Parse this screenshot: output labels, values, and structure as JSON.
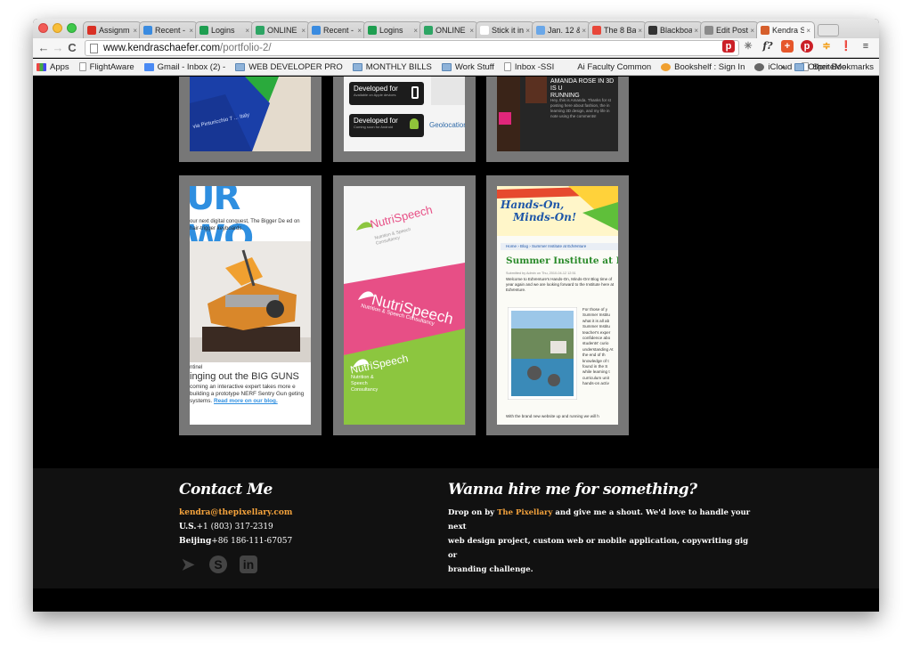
{
  "browser": {
    "tabs": [
      {
        "label": "Assignm",
        "color": "#d93025"
      },
      {
        "label": "Recent -",
        "color": "#3a8be0"
      },
      {
        "label": "Logins",
        "color": "#1e9e50"
      },
      {
        "label": "ONLINE F",
        "color": "#2da564"
      },
      {
        "label": "Recent -",
        "color": "#3a8be0"
      },
      {
        "label": "Logins",
        "color": "#1e9e50"
      },
      {
        "label": "ONLINE F",
        "color": "#2da564"
      },
      {
        "label": "Stick it in",
        "color": "#ffffff"
      },
      {
        "label": "Jan. 12 &",
        "color": "#6aa7e8"
      },
      {
        "label": "The 8 Ba",
        "color": "#e8473a"
      },
      {
        "label": "Blackboa",
        "color": "#333333"
      },
      {
        "label": "Edit Post",
        "color": "#8a8a8a"
      },
      {
        "label": "Kendra S",
        "color": "#d65f2c"
      }
    ],
    "url_host": "www.kendraschaefer.com",
    "url_path": "/portfolio-2/",
    "bookmarks": [
      {
        "label": "Apps",
        "kind": "apps"
      },
      {
        "label": "FlightAware",
        "kind": "file"
      },
      {
        "label": "Gmail - Inbox (2) - ",
        "kind": "gmail"
      },
      {
        "label": "WEB DEVELOPER PRO",
        "kind": "folder"
      },
      {
        "label": "MONTHLY BILLS",
        "kind": "folder"
      },
      {
        "label": "Work Stuff",
        "kind": "folder"
      },
      {
        "label": "Inbox -SSI",
        "kind": "file"
      },
      {
        "label": "Ai Faculty Common",
        "kind": "ai"
      },
      {
        "label": "Bookshelf : Sign In",
        "kind": "book"
      },
      {
        "label": "iCloud",
        "kind": "apple"
      },
      {
        "label": "SpriteMe",
        "kind": "file"
      }
    ],
    "other_bookmarks": "Other Bookmarks",
    "chevron": "»"
  },
  "portfolio": {
    "tile_a_top": {
      "label": "via Pinturicchio 7 ... Italy"
    },
    "tile_b_top": {
      "dev1": "Developed for",
      "dev1_sub": "Available on Apple devices",
      "dev2": "Developed for",
      "dev2_sub": "Coming soon for Android",
      "geo": "Geolocation"
    },
    "tile_c_top": {
      "head1": "AMANDA ROSE IN 3D IS U",
      "head2": "RUNNING",
      "body": "Hey, this is Amanda. Thanks for st posting here about fashion, the in learning 3D design, and my life in note using the comments!"
    },
    "tile_1": {
      "big": "UR WO",
      "intro": "our next digital conquest, The Bigger De ed on hair-trigger keyboards.",
      "tag": "ntinel",
      "head": "inging out the BIG GUNS",
      "body": "coming an interactive expert takes more e building a prototype NERF Sentry Gun geting systems.",
      "link": "Read more on our blog."
    },
    "tile_2": {
      "brand1": "NutriSpeech",
      "sub1": "Nutrition & Speech Consultancy",
      "brand2": "NutriSpeech",
      "sub2": "Nutrition & Speech Consultancy",
      "brand3": "NutriSpeech",
      "sub3": "Nutrition & Speech Consultancy"
    },
    "tile_3": {
      "logo1": "Hands-On,",
      "logo2": "Minds-On!",
      "crumb": "Home › Blog › Summer Institute at EdVenture",
      "title": "Summer Institute at Ed",
      "meta": "Submitted by Admin on Thu, 2010-04-12 12:51",
      "intro": "Welcome to EdVenture's Hands-On, Minds-On! Blog time of year again and we are looking forward to the Institute here at EdVenture.",
      "body": "For those of y Summer Institu what it is all ab Summer Institu teacher's exper confidence abo students' curio understanding At the end of th knowledge of t found in the S while learning t curriculum unit hands-on activ",
      "footer": "With the brand new website up and running we will h"
    }
  },
  "footer": {
    "contact_heading": "Contact Me",
    "email": "kendra@thepixellary.com",
    "us_label": "U.S.",
    "us_phone": "+1 (803) 317-2319",
    "beijing_label": "Beijing",
    "beijing_phone": "+86 186-111-67057",
    "hire_heading": "Wanna hire me for something?",
    "hire_pre": "Drop on by ",
    "hire_link": "The Pixellary",
    "hire_post1": " and give me a shout. We'd love to handle your next",
    "hire_line2": "web design project, custom web or mobile application, copywriting gig or",
    "hire_line3": "branding challenge."
  }
}
